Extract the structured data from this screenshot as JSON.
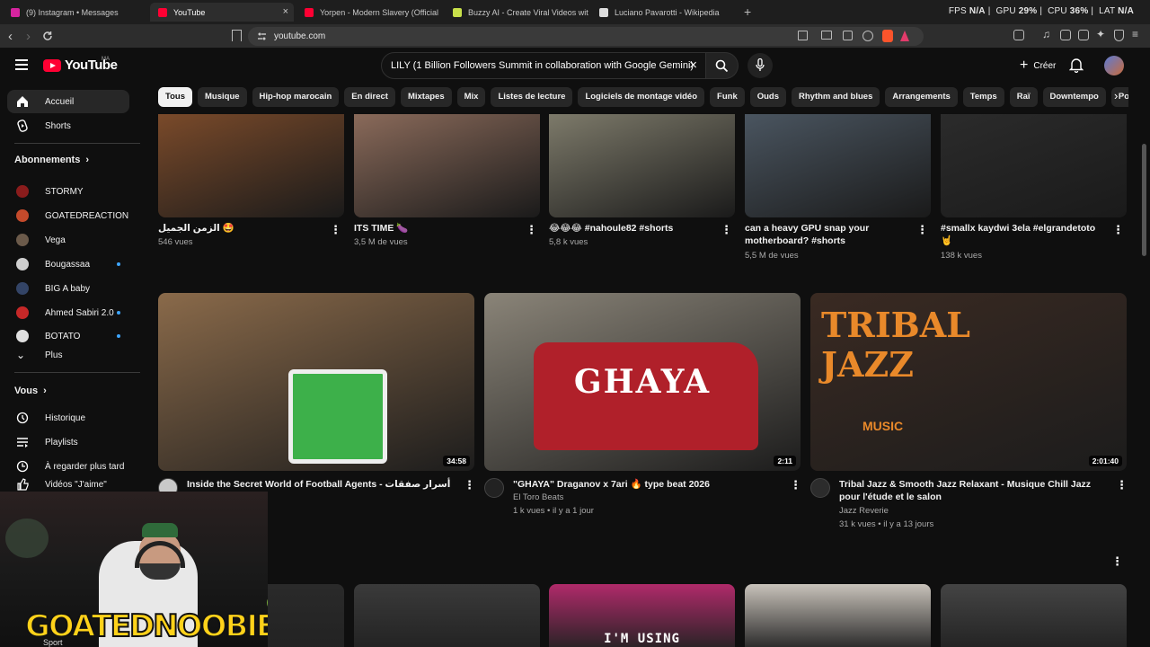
{
  "browser": {
    "tabs": [
      {
        "title": "(9) Instagram • Messages",
        "color": "#d6249f"
      },
      {
        "title": "YouTube",
        "color": "#ff0033"
      },
      {
        "title": "Yorpen - Modern Slavery (Official Au",
        "color": "#ff0033"
      },
      {
        "title": "Buzzy AI - Create Viral Videos with AI",
        "color": "#c8e04a"
      },
      {
        "title": "Luciano Pavarotti - Wikipedia",
        "color": "#dddddd"
      }
    ],
    "close_glyph": "×",
    "new_tab": "+",
    "url": "youtube.com",
    "perf": {
      "fps_label": "FPS",
      "fps": "N/A",
      "gpu_label": "GPU",
      "gpu": "29%",
      "cpu_label": "CPU",
      "cpu": "36%",
      "lat_label": "LAT",
      "lat": "N/A"
    }
  },
  "youtube": {
    "logo": "YouTube",
    "country": "MA",
    "search_query": "LILY (1 Billion Followers Summit in collaboration with Google Gemini)",
    "create_label": "Créer",
    "chips": [
      "Tous",
      "Musique",
      "Hip-hop marocain",
      "En direct",
      "Mixtapes",
      "Mix",
      "Listes de lecture",
      "Logiciels de montage vidéo",
      "Funk",
      "Ouds",
      "Rhythm and blues",
      "Arrangements",
      "Temps",
      "Raï",
      "Downtempo",
      "Pop"
    ],
    "sidebar": {
      "home": "Accueil",
      "shorts": "Shorts",
      "subs_header": "Abonnements",
      "subs": [
        {
          "name": "STORMY",
          "color": "#8a1c1c",
          "dot": false
        },
        {
          "name": "GOATEDREACTION",
          "color": "#c44a2b",
          "dot": false
        },
        {
          "name": "Vega",
          "color": "#6b5a4a",
          "dot": false
        },
        {
          "name": "Bougassaa",
          "color": "#cfcfcf",
          "dot": true
        },
        {
          "name": "BIG A baby",
          "color": "#334466",
          "dot": false
        },
        {
          "name": "Ahmed Sabiri 2.0",
          "color": "#c62828",
          "dot": true
        },
        {
          "name": "BOTATO",
          "color": "#e0e0e0",
          "dot": true
        }
      ],
      "more": "Plus",
      "you_header": "Vous",
      "you": [
        "Historique",
        "Playlists",
        "À regarder plus tard",
        "Vidéos \"J'aime\""
      ],
      "extra": "Sport"
    },
    "shorts": [
      {
        "title": "الزمن الجميل 🤩",
        "views": "546 vues",
        "bg": "#7a4a2a"
      },
      {
        "title": "ITS TIME 🍆",
        "views": "3,5 M de vues",
        "bg": "#8a6a5a"
      },
      {
        "title": "😂😂😂 #nahoule82 #shorts",
        "views": "5,8 k vues",
        "bg": "#7d7a6a"
      },
      {
        "title": "can a heavy GPU snap your motherboard? #shorts",
        "views": "5,5 M de vues",
        "bg": "#4a5560"
      },
      {
        "title": "#smallx kaydwi 3ela #elgrandetoto 🤘",
        "views": "138 k vues",
        "bg": "#2b2b2b"
      }
    ],
    "videos": [
      {
        "title": "Inside the Secret World of Football Agents - أسرار صفقات الكورة",
        "channel": "",
        "meta": "",
        "duration": "34:58",
        "bg": "#8a6a4a"
      },
      {
        "title": "\"GHAYA\" Draganov x 7ari 🔥 type beat 2026",
        "channel": "El Toro Beats",
        "meta": "1 k vues • il y a 1 jour",
        "duration": "2:11",
        "bg": "#8a8478",
        "overlay": "GHAYA"
      },
      {
        "title": "Tribal Jazz & Smooth Jazz Relaxant - Musique Chill Jazz pour l'étude et le salon",
        "channel": "Jazz Reverie",
        "meta": "31 k vues • il y a 13 jours",
        "duration": "2:01:40",
        "bg": "#3a2a22",
        "overlay": "TRIBAL JAZZ",
        "overlay2": "MUSIC"
      }
    ],
    "bottom_row": [
      {
        "bg": "#2a2a2a"
      },
      {
        "bg": "#3a3a3a"
      },
      {
        "bg": "#b02a6a",
        "caption": "I'M USING"
      },
      {
        "bg": "#c8c2ba"
      },
      {
        "bg": "#444444"
      }
    ],
    "webcam_text": "GOATEDNOOBIE",
    "webcam_number": "9"
  }
}
